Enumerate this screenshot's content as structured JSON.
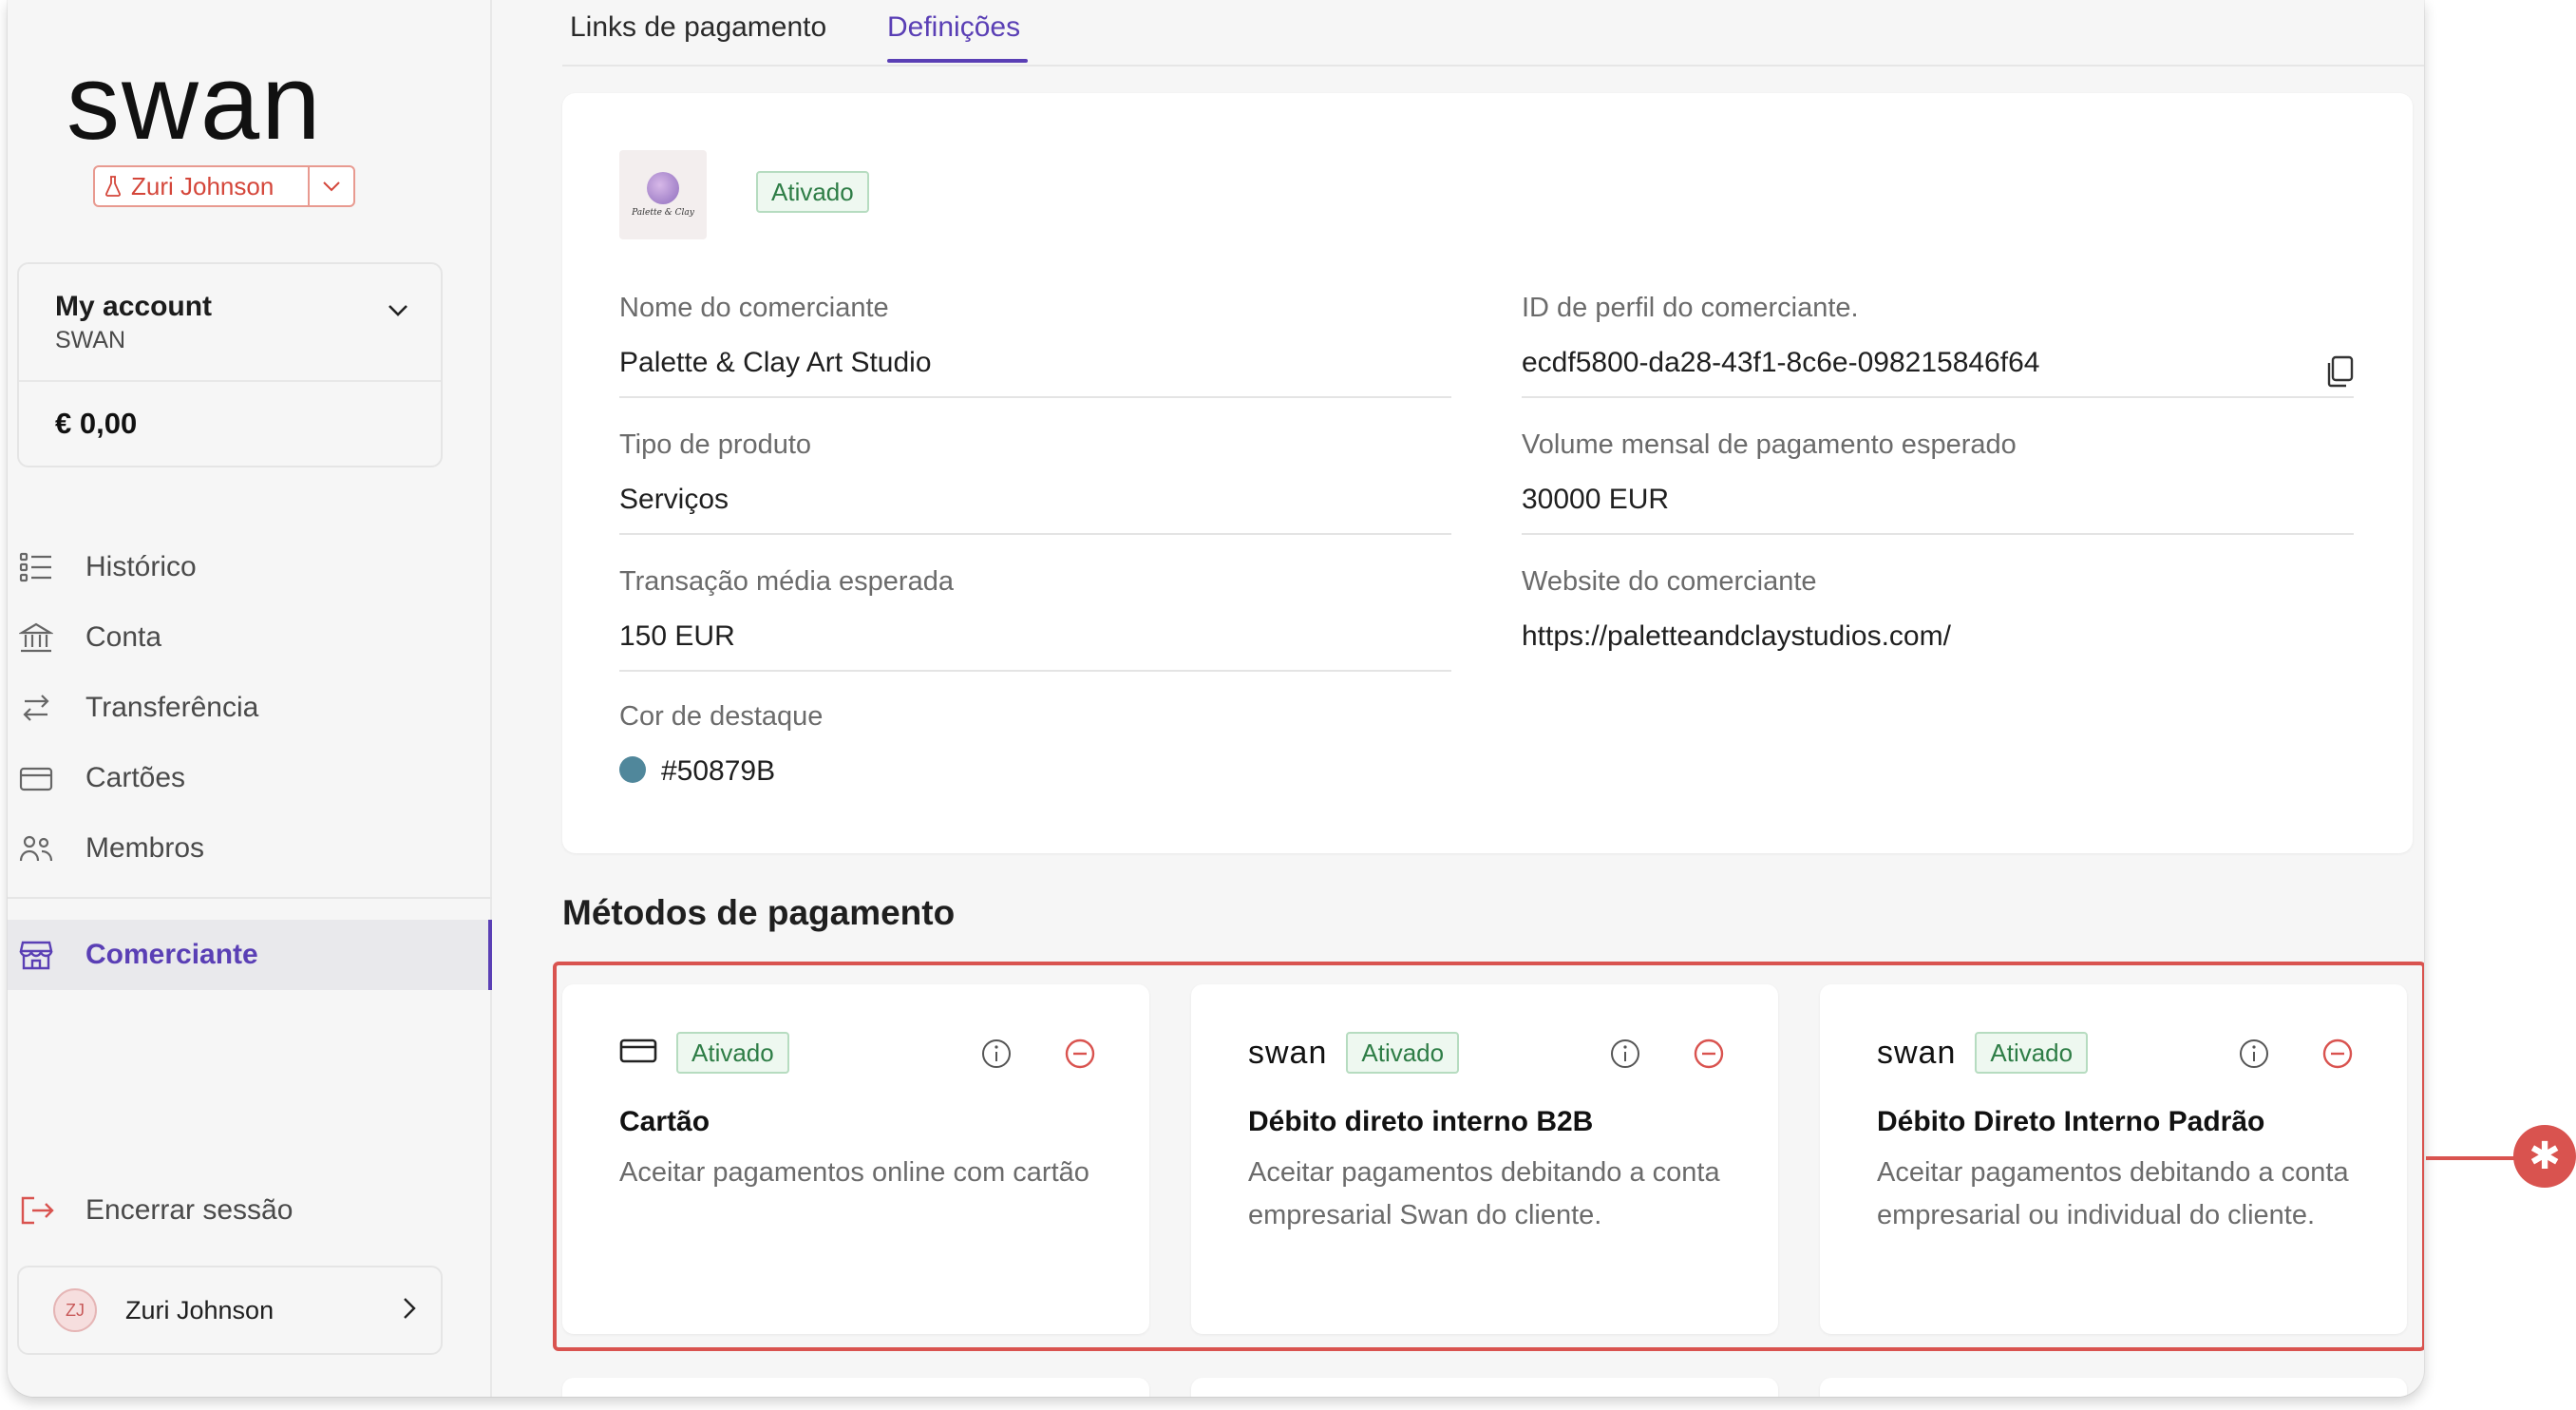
{
  "brand": {
    "logo_text": "swan",
    "accent": "#5a3fb5",
    "status_green": "#2e7d46",
    "danger": "#d9534f"
  },
  "project": {
    "name": "Zuri Johnson"
  },
  "account": {
    "title": "My account",
    "subtitle": "SWAN",
    "balance": "€ 0,00"
  },
  "nav": {
    "items": [
      {
        "label": "Histórico",
        "icon": "list-icon"
      },
      {
        "label": "Conta",
        "icon": "bank-icon"
      },
      {
        "label": "Transferência",
        "icon": "transfer-arrows-icon"
      },
      {
        "label": "Cartões",
        "icon": "card-icon"
      },
      {
        "label": "Membros",
        "icon": "members-icon"
      }
    ],
    "active": {
      "label": "Comerciante",
      "icon": "store-icon"
    },
    "logout": "Encerrar sessão"
  },
  "user": {
    "initials": "ZJ",
    "name": "Zuri Johnson"
  },
  "tabs": {
    "payment_links": "Links de pagamento",
    "settings": "Definições",
    "active": "Definições"
  },
  "merchant": {
    "status": "Ativado",
    "logo_text": "Palette & Clay",
    "fields": {
      "name_label": "Nome do comerciante",
      "name_value": "Palette & Clay Art Studio",
      "id_label": "ID de perfil do comerciante.",
      "id_value": "ecdf5800-da28-43f1-8c6e-098215846f64",
      "product_label": "Tipo de produto",
      "product_value": "Serviços",
      "volume_label": "Volume mensal de pagamento esperado",
      "volume_value": "30000 EUR",
      "avg_label": "Transação média esperada",
      "avg_value": "150 EUR",
      "website_label": "Website do comerciante",
      "website_value": "https://paletteandclaystudios.com/",
      "color_label": "Cor de destaque",
      "color_value": "#50879B"
    }
  },
  "payment_methods": {
    "title": "Métodos de pagamento",
    "cards": [
      {
        "logo": "",
        "status": "Ativado",
        "title": "Cartão",
        "description": "Aceitar pagamentos online com cartão"
      },
      {
        "logo": "swan",
        "status": "Ativado",
        "title": "Débito direto interno B2B",
        "description": "Aceitar pagamentos debitando a conta empresarial Swan do cliente."
      },
      {
        "logo": "swan",
        "status": "Ativado",
        "title": "Débito Direto Interno Padrão",
        "description": "Aceitar pagamentos debitando a conta empresarial ou individual do cliente."
      }
    ]
  },
  "callout": {
    "symbol": "✱"
  }
}
